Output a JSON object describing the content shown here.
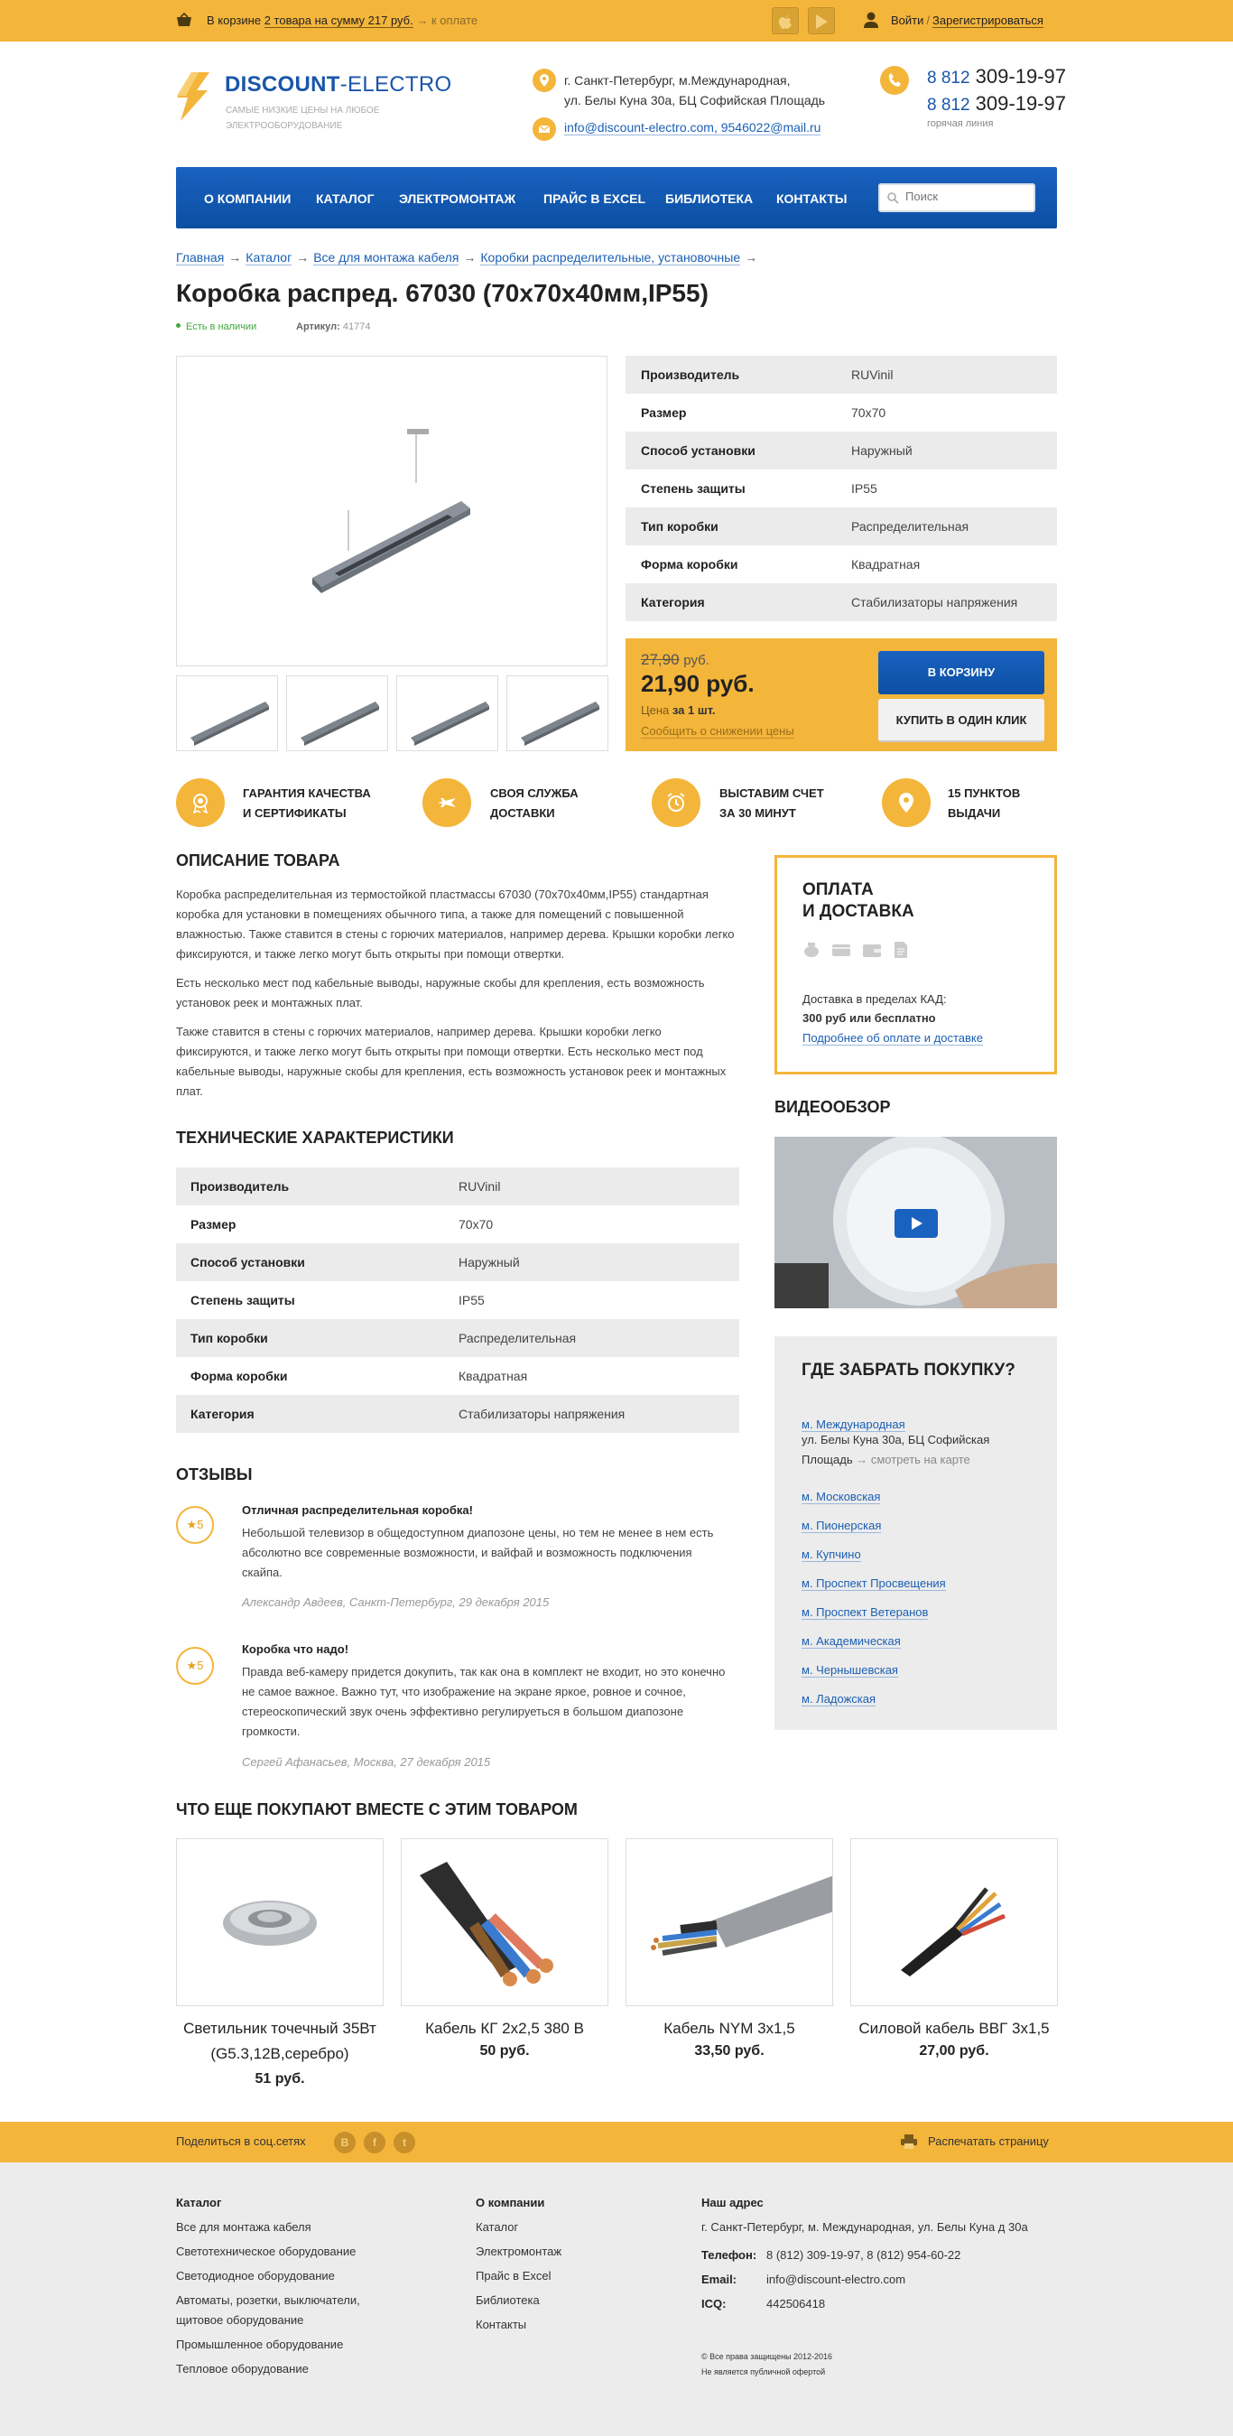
{
  "topbar": {
    "cart_prefix": "В корзине",
    "cart_link": "2 товара на сумму 217 руб.",
    "cart_go": "→ к оплате",
    "login": "Войти",
    "sep": "/",
    "register": "Зарегистрироваться"
  },
  "header": {
    "logo_bold": "DISCOUNT",
    "logo_light": "-ELECTRO",
    "tagline": "Самые низкие цены на любое электрооборудование",
    "address_1": "г. Санкт-Петербург, м.Международная,",
    "address_2": "ул. Белы Куна 30а, БЦ Софийская Площадь",
    "email": "info@discount-electro.com, 9546022@mail.ru",
    "phone_code_1": "8 812",
    "phone_num_1": "309-19-97",
    "phone_code_2": "8 812",
    "phone_num_2": "309-19-97",
    "hotline": "горячая линия"
  },
  "nav": {
    "items": [
      "О компании",
      "Каталог",
      "Электромонтаж",
      "Прайс в Excel",
      "Библиотека",
      "Контакты"
    ],
    "search_placeholder": "Поиск"
  },
  "breadcrumbs": [
    "Главная",
    "Каталог",
    "Все для монтажа кабеля",
    "Коробки распределительные, установочные"
  ],
  "breadcrumb_sep": "→",
  "product": {
    "title": "Коробка распред. 67030 (70х70х40мм,IP55)",
    "stock": "Есть в наличии",
    "sku_label": "Артикул:",
    "sku": "41774",
    "specs": [
      {
        "k": "Производитель",
        "v": "RUVinil"
      },
      {
        "k": "Размер",
        "v": "70x70"
      },
      {
        "k": "Способ установки",
        "v": "Наружный"
      },
      {
        "k": "Степень защиты",
        "v": "IP55"
      },
      {
        "k": "Тип коробки",
        "v": "Распределительная"
      },
      {
        "k": "Форма коробки",
        "v": "Квадратная"
      },
      {
        "k": "Категория",
        "v": "Стабилизаторы напряжения"
      }
    ],
    "old_price": "27,90",
    "old_cur": "руб.",
    "price": "21,90 руб.",
    "per_prefix": "Цена",
    "per_bold": "за 1 шт.",
    "notify": "Сообщить о снижении цены",
    "btn_cart": "В корзину",
    "btn_one": "Купить в один клик"
  },
  "features": [
    {
      "l1": "Гарантия качества",
      "l2": "и сертификаты"
    },
    {
      "l1": "Своя служба",
      "l2": "доставки"
    },
    {
      "l1": "Выставим счет",
      "l2": "за 30 минут"
    },
    {
      "l1": "15 пунктов",
      "l2": "выдачи"
    }
  ],
  "description": {
    "heading": "Описание товара",
    "p1": "Коробка распределительная из термостойкой пластмассы  67030 (70х70х40мм,IP55) стандартная коробка для установки в помещениях обычного типа, а также для помещений  с повышенной влажностью. Также ставится в стены с горючих материалов, например дерева. Крышки коробки легко фиксируются, и также легко могут быть открыты при помощи отвертки.",
    "p2": "Есть несколько мест под кабельные выводы, наружные скобы для крепления, есть возможность установок реек и монтажных плат.",
    "p3": "Также ставится в стены с горючих материалов, например дерева. Крышки коробки легко фиксируются, и также легко могут быть открыты при помощи отвертки. Есть несколько мест под кабельные выводы, наружные скобы для крепления, есть возможность установок реек и монтажных плат."
  },
  "tech_heading": "Технические характеристики",
  "payment": {
    "title_1": "Оплата",
    "title_2": "и доставка",
    "text_1": "Доставка в пределах КАД:",
    "text_2": "300 руб или бесплатно",
    "link": "Подробнее об оплате и доставке"
  },
  "video_heading": "Видеообзор",
  "pickup": {
    "title": "Где забрать покупку?",
    "first_metro": "м. Международная",
    "address": "ул. Белы Куна 30а, БЦ Софийская Площадь",
    "map_link": "→ смотреть на карте",
    "metros": [
      "м. Московская",
      "м. Пионерская",
      "м. Купчино",
      "м. Проспект Просвещения",
      "м. Проспект Ветеранов",
      "м. Академическая",
      "м. Чернышевская",
      "м. Ладожская"
    ]
  },
  "reviews": {
    "heading": "Отзывы",
    "items": [
      {
        "rating": "★5",
        "title": "Отличная распределительная коробка!",
        "text": "Небольшой телевизор в общедоступном диапозоне цены, но тем не менее в нем есть абсолютно все современные возможности, и вайфай и возможность подключения скайпа.",
        "author": "Александр Авдеев, Санкт-Петербург, 29 декабря 2015"
      },
      {
        "rating": "★5",
        "title": "Коробка что надо!",
        "text": "Правда веб-камеру придется докупить, так как она в комплект не входит, но это конечно не самое важное. Важно тут, что изображение на экране яркое, ровное и сочное, стереоскопический звук очень эффективно регулируеться в большом диапозоне громкости.",
        "author": "Сергей Афанасьев, Москва, 27 декабря 2015"
      }
    ]
  },
  "related": {
    "heading": "Что еще покупают вместе с этим товаром",
    "items": [
      {
        "name": "Светильник точечный 35Вт (G5.3,12В,серебро)",
        "price": "51 руб."
      },
      {
        "name": "Кабель КГ 2х2,5 380 В",
        "price": "50 руб."
      },
      {
        "name": "Кабель NYM 3х1,5",
        "price": "33,50 руб."
      },
      {
        "name": "Силовой кабель ВВГ 3х1,5",
        "price": "27,00 руб."
      }
    ]
  },
  "share": {
    "label": "Поделиться в соц.сетях",
    "vk": "В",
    "fb": "f",
    "tw": "t",
    "print": "Распечатать страницу"
  },
  "footer": {
    "col1_title": "Каталог",
    "col1": [
      "Все для монтажа кабеля",
      "Светотехническое оборудование",
      "Светодиодное оборудование",
      "Автоматы, розетки, выключатели, щитовое оборудование",
      "Промышленное оборудование",
      "Тепловое оборудование"
    ],
    "col2_title": "О компании",
    "col2": [
      "Каталог",
      "Электромонтаж",
      "Прайс в Excel",
      "Библиотека",
      "Контакты"
    ],
    "col3_title": "Наш адрес",
    "address": "г. Санкт-Петербург, м. Международная, ул. Белы Куна д 30а",
    "phone_label": "Телефон:",
    "phone": "8 (812) 309-19-97, 8 (812) 954-60-22",
    "email_label": "Email:",
    "email": "info@discount-electro.com",
    "icq_label": "ICQ:",
    "icq": "442506418",
    "copy_1": "© Все права защищены 2012-2016",
    "copy_2": "Не является публичной офертой"
  },
  "colors": {
    "accent": "#f4b53b",
    "brand": "#1a56a8",
    "text": "#222222"
  }
}
